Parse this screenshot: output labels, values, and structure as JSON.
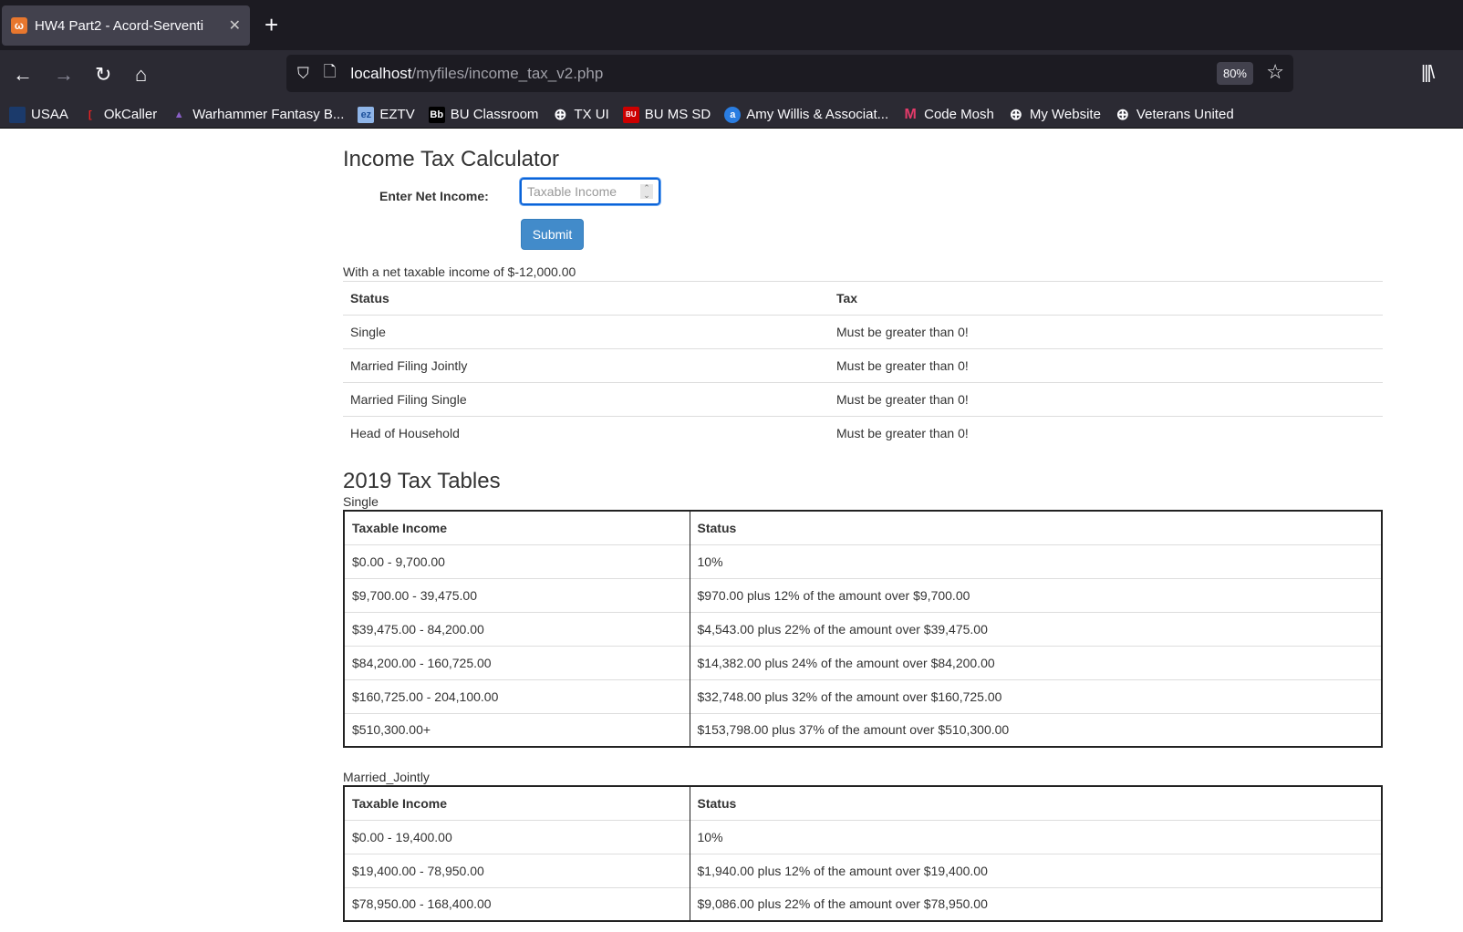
{
  "browser": {
    "tab_title": "HW4 Part2 - Acord-Serventi",
    "url_host": "localhost",
    "url_path": "/myfiles/income_tax_v2.php",
    "zoom": "80%",
    "bookmarks": [
      "USAA",
      "OkCaller",
      "Warhammer Fantasy B...",
      "EZTV",
      "BU Classroom",
      "TX UI",
      "BU MS SD",
      "Amy Willis & Associat...",
      "Code Mosh",
      "My Website",
      "Veterans United"
    ]
  },
  "form": {
    "title": "Income Tax Calculator",
    "label": "Enter Net Income:",
    "placeholder": "Taxable  Income",
    "submit": "Submit"
  },
  "result": {
    "text": "With a net taxable income of $-12,000.00",
    "headers": [
      "Status",
      "Tax"
    ],
    "rows": [
      [
        "Single",
        "Must be greater than 0!"
      ],
      [
        "Married Filing Jointly",
        "Must be greater than 0!"
      ],
      [
        "Married Filing Single",
        "Must be greater than 0!"
      ],
      [
        "Head of Household",
        "Must be greater than 0!"
      ]
    ]
  },
  "tables": {
    "title": "2019 Tax Tables",
    "headers": [
      "Taxable Income",
      "Status"
    ],
    "single": {
      "caption": "Single",
      "rows": [
        [
          "$0.00 - 9,700.00",
          "10%"
        ],
        [
          "$9,700.00 - 39,475.00",
          "$970.00 plus 12% of the amount over $9,700.00"
        ],
        [
          "$39,475.00 - 84,200.00",
          "$4,543.00 plus 22% of the amount over $39,475.00"
        ],
        [
          "$84,200.00 - 160,725.00",
          "$14,382.00 plus 24% of the amount over $84,200.00"
        ],
        [
          "$160,725.00 - 204,100.00",
          "$32,748.00 plus 32% of the amount over $160,725.00"
        ],
        [
          "$510,300.00+",
          "$153,798.00 plus 37% of the amount over $510,300.00"
        ]
      ]
    },
    "married_jointly": {
      "caption": "Married_Jointly",
      "rows": [
        [
          "$0.00 - 19,400.00",
          "10%"
        ],
        [
          "$19,400.00 - 78,950.00",
          "$1,940.00 plus 12% of the amount over $19,400.00"
        ],
        [
          "$78,950.00 - 168,400.00",
          "$9,086.00 plus 22% of the amount over $78,950.00"
        ]
      ]
    }
  }
}
